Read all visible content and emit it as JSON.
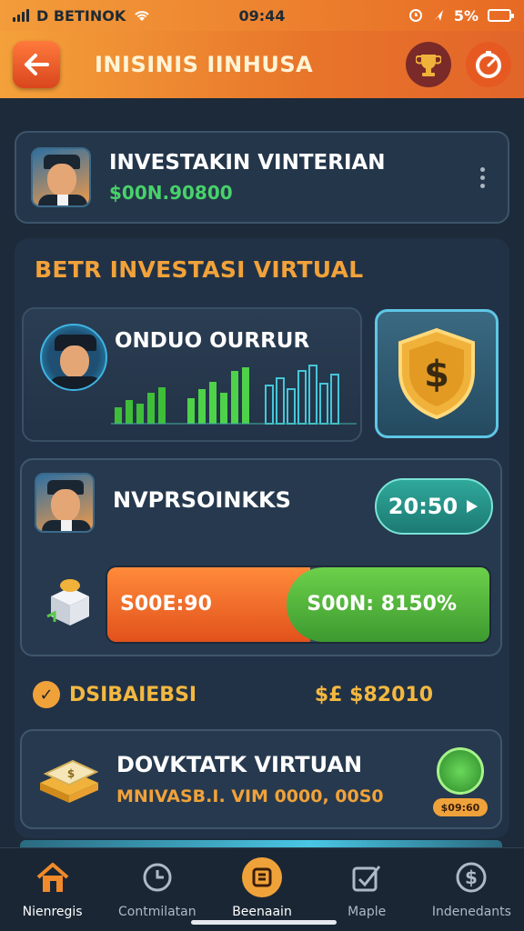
{
  "status_bar": {
    "carrier": "D BETINOK",
    "time": "09:44",
    "battery": "5%"
  },
  "header": {
    "title": "INISINIS IINHUSA",
    "back_icon": "arrow-left-icon",
    "trophy_icon": "trophy-icon",
    "timer_icon": "timer-icon"
  },
  "profile": {
    "name": "INVESTAKIN VINTERIAN",
    "balance": "$00N.90800"
  },
  "section": {
    "title": "BETR INVESTASI VIRTUAL"
  },
  "featured": {
    "name": "ONDUO OURRUR",
    "chart_icon": "bar-chart-icon",
    "shield_icon": "dollar-shield-icon"
  },
  "trade": {
    "name": "NVPRSOINKKS",
    "timer_label": "20:50",
    "left_label": "S00E:90",
    "right_label": "S00N: 8150%",
    "progress_fraction": 0.47
  },
  "distribution": {
    "label": "DSIBAIEBSI",
    "amount": "$£ $82010"
  },
  "deposit": {
    "title": "DOVKTATK VIRTUAN",
    "subtitle": "MNIVASB.I. VIM 0000,   00S0",
    "badge_text": "$09:60"
  },
  "tabs": [
    {
      "label": "Nienregis",
      "icon": "home-icon"
    },
    {
      "label": "Contmilatan",
      "icon": "clock-icon"
    },
    {
      "label": "Beenaain",
      "icon": "wallet-icon"
    },
    {
      "label": "Maple",
      "icon": "checklist-icon"
    },
    {
      "label": "Indenedants",
      "icon": "dollar-icon"
    }
  ],
  "colors": {
    "accent_orange": "#f08a2a",
    "gold": "#f2a23a",
    "green": "#48d26a",
    "background": "#1c2a3a"
  }
}
